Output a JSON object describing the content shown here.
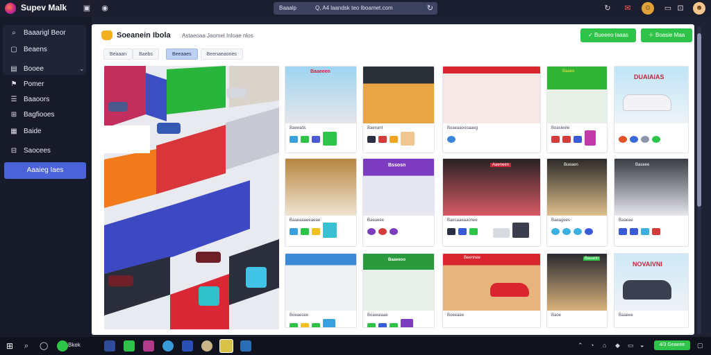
{
  "app": {
    "title": "Supev Malk",
    "address_left": "Baaalp",
    "address_text": "Q, A4 laandsk teo Iboamet.com"
  },
  "sidebar": {
    "items": [
      {
        "label": "Baaarigl Beor",
        "icon": "search-icon"
      },
      {
        "label": "Beaens",
        "icon": "square-icon"
      },
      {
        "label": "Booee",
        "icon": "store-icon"
      },
      {
        "label": "Pomer",
        "icon": "flag-icon"
      },
      {
        "label": "Baaoors",
        "icon": "list-icon"
      },
      {
        "label": "Bagfiooes",
        "icon": "cart-icon"
      },
      {
        "label": "Baide",
        "icon": "book-icon"
      },
      {
        "label": "Saocees",
        "icon": "grid-icon"
      }
    ],
    "cta_label": "Aaaieg Iaes"
  },
  "main": {
    "title": "Soeanein Ibola",
    "subtitle": "Astaeoaa Jaomel  Inloae nlos",
    "buttons": [
      "Bueeeo laaas",
      "Boasie Maa"
    ],
    "tabs": [
      "Beaaan",
      "Baebs",
      "Beeaaes",
      "Beenaeaones"
    ],
    "active_tab": 2
  },
  "cards": [
    {
      "thumb_text": "Baaeeen",
      "caption": "Baeeads"
    },
    {
      "thumb_text": "",
      "caption": "Baenanl"
    },
    {
      "thumb_text": "",
      "caption": "Boaeaaoooaaeg"
    },
    {
      "thumb_text": "Baaeo",
      "caption": "Boasleele"
    },
    {
      "thumb_text": "DUAIAIAS",
      "caption": ""
    },
    {
      "thumb_text": "",
      "caption": "Baaeaaaeeaeae"
    },
    {
      "thumb_text": "Bssosn",
      "caption": "Baeaeee"
    },
    {
      "thumb_text": "Aaeneen",
      "caption": "Baesaaeaaonee"
    },
    {
      "thumb_text": "Bueaen",
      "caption": "Baeagees"
    },
    {
      "thumb_text": "Baseee",
      "caption": "Baaeae"
    },
    {
      "thumb_text": "",
      "caption": "Boeaesee"
    },
    {
      "thumb_text": "Baaeeoo",
      "caption": "Boawaiaae"
    },
    {
      "thumb_text": "Beennee",
      "caption": "Boeeaee"
    },
    {
      "thumb_text": "Basann",
      "caption": "Baoe"
    },
    {
      "thumb_text": "NOVAIVNI",
      "caption": "Baaeee"
    }
  ],
  "taskbar": {
    "label": "Bkek",
    "tray_label": "4/3 Geaeee"
  },
  "colors": {
    "accent_green": "#2ec44a",
    "accent_blue": "#4a63d8",
    "sidebar_bg": "#161a29",
    "topbar_bg": "#1b1e2e"
  }
}
